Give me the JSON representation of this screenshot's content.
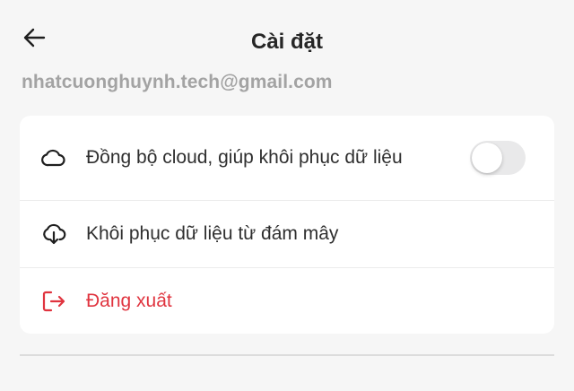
{
  "header": {
    "title": "Cài đặt",
    "back_icon": "arrow-left-icon"
  },
  "account": {
    "email": "nhatcuonghuynh.tech@gmail.com"
  },
  "settings": {
    "items": [
      {
        "label": "Đồng bộ cloud, giúp khôi phục dữ liệu",
        "icon": "cloud-icon",
        "toggle_on": false
      },
      {
        "label": "Khôi phục dữ liệu từ đám mây",
        "icon": "cloud-download-icon"
      },
      {
        "label": "Đăng xuất",
        "icon": "logout-icon",
        "color": "#e0343f"
      }
    ]
  },
  "colors": {
    "background": "#f6f6f6",
    "card": "#ffffff",
    "danger": "#e0343f",
    "muted_text": "#a3a3a3"
  }
}
